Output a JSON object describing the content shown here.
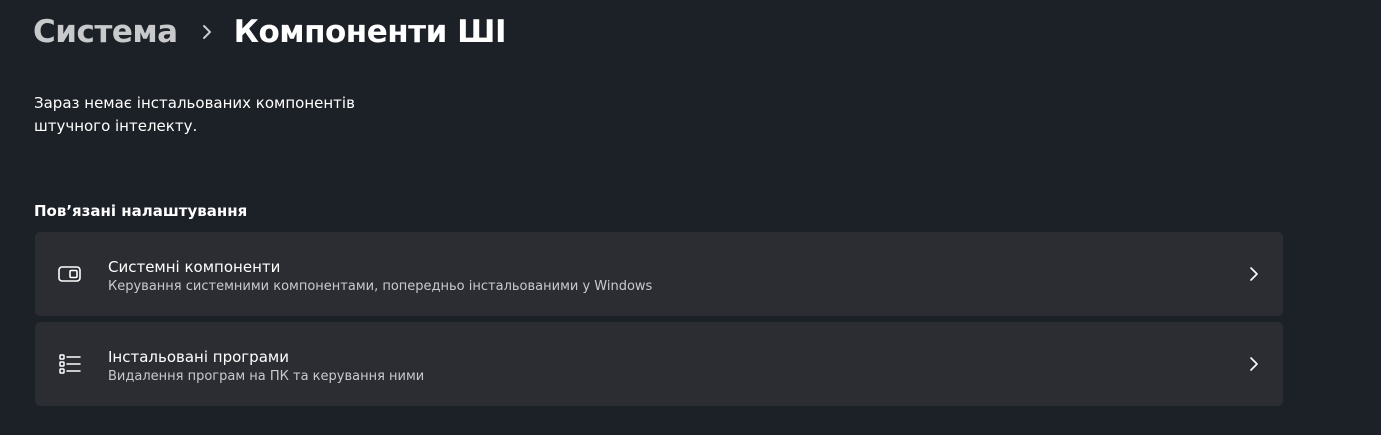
{
  "breadcrumb": {
    "parent": "Система",
    "current": "Компоненти ШІ"
  },
  "empty_message": "Зараз немає інстальованих компонентів штучного інтелекту.",
  "related_settings": {
    "title": "Пов’язані налаштування",
    "items": [
      {
        "icon": "system-components-icon",
        "title": "Системні компоненти",
        "subtitle": "Керування системними компонентами, попередньо інстальованими у Windows"
      },
      {
        "icon": "installed-apps-icon",
        "title": "Інстальовані програми",
        "subtitle": "Видалення програм на ПК та керування ними"
      }
    ]
  },
  "colors": {
    "background": "#1c2027",
    "card": "#2b2d33",
    "text": "#ffffff",
    "secondary_text": "#c9cacd"
  }
}
